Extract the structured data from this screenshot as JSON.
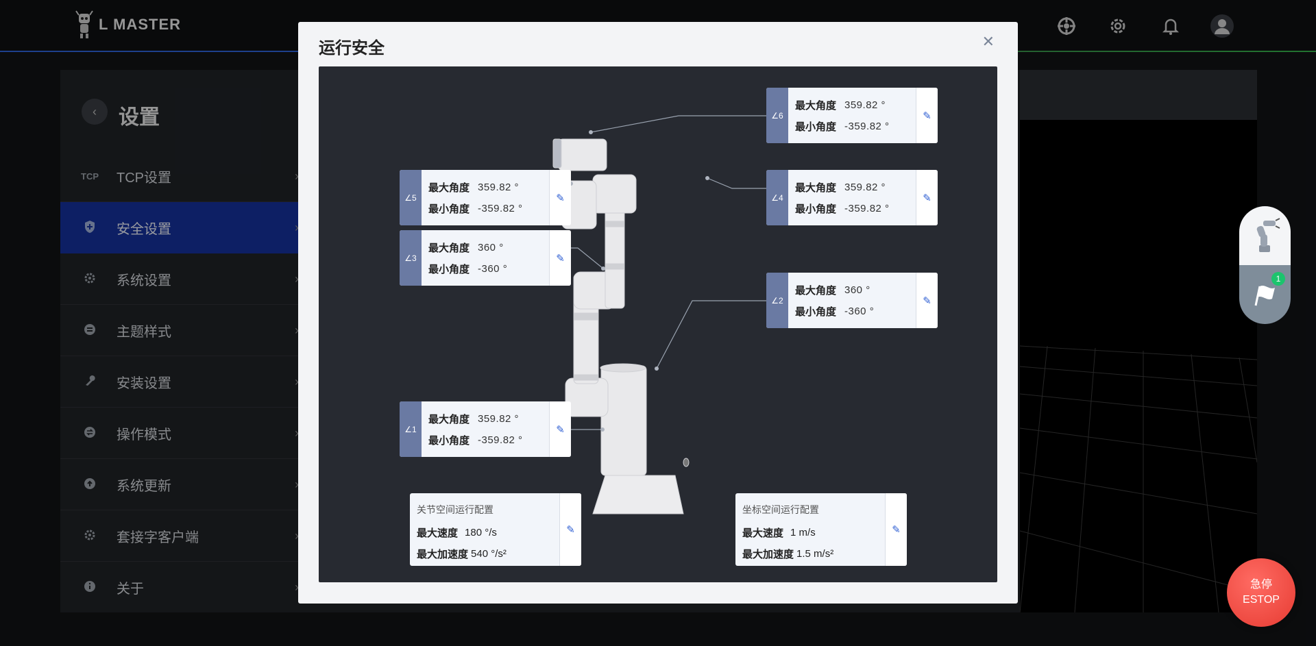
{
  "app": {
    "logo_text": "L MASTER"
  },
  "topbar": {
    "icons": [
      "crosshair-icon",
      "gear-icon",
      "bell-icon",
      "user-avatar-icon"
    ]
  },
  "sidebar": {
    "title": "设置",
    "items": [
      {
        "icon_text": "TCP",
        "label": "TCP设置",
        "active": false
      },
      {
        "icon_text": "",
        "label": "安全设置",
        "active": true
      },
      {
        "icon_text": "",
        "label": "系统设置",
        "active": false
      },
      {
        "icon_text": "",
        "label": "主题样式",
        "active": false
      },
      {
        "icon_text": "",
        "label": "安装设置",
        "active": false
      },
      {
        "icon_text": "",
        "label": "操作模式",
        "active": false
      },
      {
        "icon_text": "",
        "label": "系统更新",
        "active": false
      },
      {
        "icon_text": "",
        "label": "套接字客户端",
        "active": false
      },
      {
        "icon_text": "",
        "label": "关于",
        "active": false
      }
    ]
  },
  "modal": {
    "title": "运行安全",
    "joints": [
      {
        "id": "j6",
        "tag": "∠6",
        "max_label": "最大角度",
        "max": "359.82 °",
        "min_label": "最小角度",
        "min": "-359.82 °"
      },
      {
        "id": "j5",
        "tag": "∠5",
        "max_label": "最大角度",
        "max": "359.82 °",
        "min_label": "最小角度",
        "min": "-359.82 °"
      },
      {
        "id": "j4",
        "tag": "∠4",
        "max_label": "最大角度",
        "max": "359.82 °",
        "min_label": "最小角度",
        "min": "-359.82 °"
      },
      {
        "id": "j3",
        "tag": "∠3",
        "max_label": "最大角度",
        "max": "360 °",
        "min_label": "最小角度",
        "min": "-360 °"
      },
      {
        "id": "j2",
        "tag": "∠2",
        "max_label": "最大角度",
        "max": "360 °",
        "min_label": "最小角度",
        "min": "-360 °"
      },
      {
        "id": "j1",
        "tag": "∠1",
        "max_label": "最大角度",
        "max": "359.82 °",
        "min_label": "最小角度",
        "min": "-359.82 °"
      }
    ],
    "joint_space": {
      "title": "关节空间运行配置",
      "speed_label": "最大速度",
      "speed": "180 °/s",
      "acc_label": "最大加速度",
      "acc": "540 °/s²"
    },
    "cart_space": {
      "title": "坐标空间运行配置",
      "speed_label": "最大速度",
      "speed": "1 m/s",
      "acc_label": "最大加速度",
      "acc": "1.5 m/s²"
    }
  },
  "fab": {
    "badge": "1"
  },
  "estop": {
    "line1": "急停",
    "line2": "ESTOP"
  }
}
